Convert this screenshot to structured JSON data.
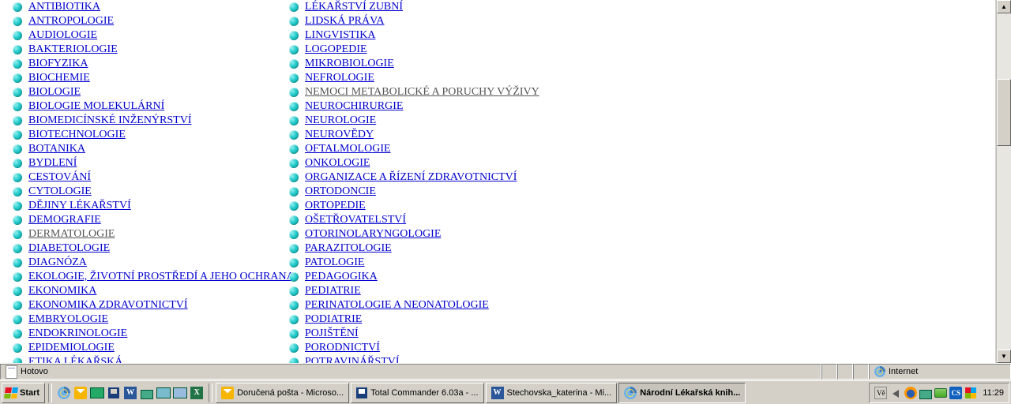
{
  "columns": {
    "left": [
      {
        "label": "ANTIBIOTIKA"
      },
      {
        "label": "ANTROPOLOGIE"
      },
      {
        "label": "AUDIOLOGIE"
      },
      {
        "label": "BAKTERIOLOGIE"
      },
      {
        "label": "BIOFYZIKA"
      },
      {
        "label": "BIOCHEMIE"
      },
      {
        "label": "BIOLOGIE"
      },
      {
        "label": "BIOLOGIE MOLEKULÁRNÍ"
      },
      {
        "label": "BIOMEDICÍNSKÉ INŽENÝRSTVÍ"
      },
      {
        "label": "BIOTECHNOLOGIE"
      },
      {
        "label": "BOTANIKA"
      },
      {
        "label": "BYDLENÍ"
      },
      {
        "label": "CESTOVÁNÍ"
      },
      {
        "label": "CYTOLOGIE"
      },
      {
        "label": "DĚJINY LÉKAŘSTVÍ"
      },
      {
        "label": "DEMOGRAFIE"
      },
      {
        "label": "DERMATOLOGIE",
        "visited": true
      },
      {
        "label": "DIABETOLOGIE"
      },
      {
        "label": "DIAGNÓZA"
      },
      {
        "label": "EKOLOGIE, ŽIVOTNÍ PROSTŘEDÍ A JEHO OCHRANA"
      },
      {
        "label": "EKONOMIKA"
      },
      {
        "label": "EKONOMIKA ZDRAVOTNICTVÍ"
      },
      {
        "label": "EMBRYOLOGIE"
      },
      {
        "label": "ENDOKRINOLOGIE"
      },
      {
        "label": "EPIDEMIOLOGIE"
      },
      {
        "label": "ETIKA LÉKAŘSKÁ"
      }
    ],
    "right": [
      {
        "label": "LÉKAŘSTVÍ ZUBNÍ"
      },
      {
        "label": "LIDSKÁ PRÁVA"
      },
      {
        "label": "LINGVISTIKA"
      },
      {
        "label": "LOGOPEDIE"
      },
      {
        "label": "MIKROBIOLOGIE"
      },
      {
        "label": "NEFROLOGIE"
      },
      {
        "label": "NEMOCI METABOLICKÉ A PORUCHY VÝŽIVY",
        "visited": true
      },
      {
        "label": "NEUROCHIRURGIE"
      },
      {
        "label": "NEUROLOGIE"
      },
      {
        "label": "NEUROVĚDY"
      },
      {
        "label": "OFTALMOLOGIE"
      },
      {
        "label": "ONKOLOGIE"
      },
      {
        "label": "ORGANIZACE A ŘÍZENÍ ZDRAVOTNICTVÍ"
      },
      {
        "label": "ORTODONCIE"
      },
      {
        "label": "ORTOPEDIE"
      },
      {
        "label": "OŠETŘOVATELSTVÍ"
      },
      {
        "label": "OTORINOLARYNGOLOGIE"
      },
      {
        "label": "PARAZITOLOGIE"
      },
      {
        "label": "PATOLOGIE"
      },
      {
        "label": "PEDAGOGIKA"
      },
      {
        "label": "PEDIATRIE"
      },
      {
        "label": "PERINATOLOGIE A NEONATOLOGIE"
      },
      {
        "label": "PODIATRIE"
      },
      {
        "label": "POJIŠTĚNÍ"
      },
      {
        "label": "PORODNICTVÍ"
      },
      {
        "label": "POTRAVINÁŘSTVÍ"
      }
    ]
  },
  "status": {
    "text": "Hotovo",
    "zone": "Internet"
  },
  "taskbar": {
    "start": "Start",
    "items": [
      "Doručená pošta - Microso...",
      "Total Commander 6.03a - ...",
      "Stechovska_katerina - Mi...",
      "Národní Lékařská knih..."
    ],
    "clock": "11:29"
  }
}
